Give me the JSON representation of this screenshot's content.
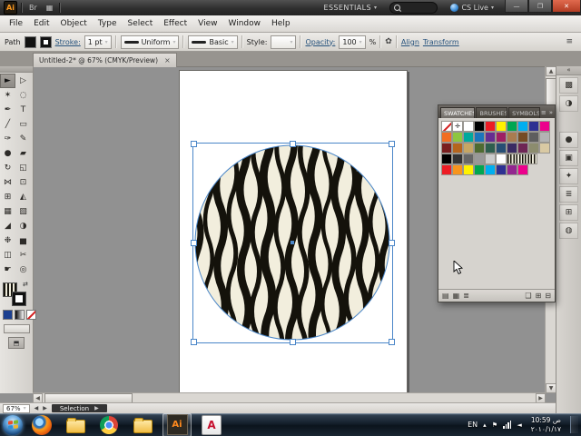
{
  "colors": {
    "selection_blue": "#4a86c8",
    "zebra_ink": "#14120b",
    "zebra_bg": "#f2eedd"
  },
  "titlebar": {
    "app_icon": "Ai",
    "bridge_icon": "Br",
    "arrange_icon_glyph": "▦",
    "workspace_button": "ESSENTIALS",
    "search_placeholder": "",
    "cs_live_button": "CS Live",
    "minimize": "—",
    "restore": "❐",
    "close": "✕"
  },
  "menubar": {
    "items": [
      "File",
      "Edit",
      "Object",
      "Type",
      "Select",
      "Effect",
      "View",
      "Window",
      "Help"
    ]
  },
  "controlbar": {
    "object_type": "Path",
    "stroke_link": "Stroke:",
    "stroke_weight": "1 pt",
    "width_profile": "Uniform",
    "brush_definition": "Basic",
    "style_label": "Style:",
    "opacity_link": "Opacity:",
    "opacity_value": "100",
    "opacity_unit": "%",
    "recolor_glyph": "✿",
    "align_link": "Align",
    "transform_link": "Transform",
    "panel_menu_glyph": "≡"
  },
  "tabbar": {
    "document_title": "Untitled-2* @ 67% (CMYK/Preview)",
    "close": "×"
  },
  "toolbar": {
    "active_index": 0,
    "tools": [
      {
        "name": "selection-tool-icon",
        "glyph": "►"
      },
      {
        "name": "direct-selection-tool-icon",
        "glyph": "▷"
      },
      {
        "name": "magic-wand-tool-icon",
        "glyph": "✶"
      },
      {
        "name": "lasso-tool-icon",
        "glyph": "◌"
      },
      {
        "name": "pen-tool-icon",
        "glyph": "✒"
      },
      {
        "name": "type-tool-icon",
        "glyph": "T"
      },
      {
        "name": "line-segment-tool-icon",
        "glyph": "╱"
      },
      {
        "name": "rectangle-tool-icon",
        "glyph": "▭"
      },
      {
        "name": "paintbrush-tool-icon",
        "glyph": "✑"
      },
      {
        "name": "pencil-tool-icon",
        "glyph": "✎"
      },
      {
        "name": "blob-brush-tool-icon",
        "glyph": "●"
      },
      {
        "name": "eraser-tool-icon",
        "glyph": "▰"
      },
      {
        "name": "rotate-tool-icon",
        "glyph": "↻"
      },
      {
        "name": "scale-tool-icon",
        "glyph": "◱"
      },
      {
        "name": "width-tool-icon",
        "glyph": "⋈"
      },
      {
        "name": "free-transform-tool-icon",
        "glyph": "⊡"
      },
      {
        "name": "shape-builder-tool-icon",
        "glyph": "⊞"
      },
      {
        "name": "perspective-grid-tool-icon",
        "glyph": "◭"
      },
      {
        "name": "mesh-tool-icon",
        "glyph": "▦"
      },
      {
        "name": "gradient-tool-icon",
        "glyph": "▧"
      },
      {
        "name": "eyedropper-tool-icon",
        "glyph": "◢"
      },
      {
        "name": "blend-tool-icon",
        "glyph": "◑"
      },
      {
        "name": "symbol-sprayer-tool-icon",
        "glyph": "❉"
      },
      {
        "name": "column-graph-tool-icon",
        "glyph": "▅"
      },
      {
        "name": "artboard-tool-icon",
        "glyph": "◫"
      },
      {
        "name": "slice-tool-icon",
        "glyph": "✂"
      },
      {
        "name": "hand-tool-icon",
        "glyph": "☛"
      },
      {
        "name": "zoom-tool-icon",
        "glyph": "◎"
      }
    ]
  },
  "swatches_panel": {
    "tabs": [
      "SWATCHES",
      "BRUSHES",
      "SYMBOLS"
    ],
    "active_tab": 0,
    "header_icons": [
      "≡",
      "»"
    ],
    "rows": [
      [
        "none",
        "registration",
        "#ffffff",
        "#000000",
        "#ed1c24",
        "#fff200",
        "#00a651",
        "#00aeef",
        "#2e3192",
        "#ec008c"
      ],
      [
        "#f26d21",
        "#8dc63f",
        "#00a99d",
        "#1b75bc",
        "#662d91",
        "#9e1f63",
        "#a97c50",
        "#754c24",
        "#5e5e5e",
        "#b3b3b3"
      ],
      [
        "#7a1f1f",
        "#b5651d",
        "#c6a664",
        "#4e6b31",
        "#2e5e4e",
        "#274e74",
        "#3a2b63",
        "#6e2555",
        "#8c8c6e",
        "#d9c9a3"
      ],
      [
        "#000000",
        "#333333",
        "#666666",
        "#999999",
        "#cccccc",
        "#ffffff",
        "pattern"
      ],
      [
        "#ed1c24",
        "#f7941d",
        "#fff200",
        "#00a651",
        "#00aeef",
        "#2e3192",
        "#92278f",
        "#ec008c"
      ]
    ],
    "footer_icons": [
      {
        "name": "swatch-libraries-icon",
        "glyph": "▤"
      },
      {
        "name": "swatch-kinds-icon",
        "glyph": "▦"
      },
      {
        "name": "swatch-options-icon",
        "glyph": "≣"
      },
      {
        "name": "new-color-group-icon",
        "glyph": "❑"
      },
      {
        "name": "new-swatch-icon",
        "glyph": "⊞"
      },
      {
        "name": "delete-swatch-icon",
        "glyph": "⊟"
      }
    ]
  },
  "dock": {
    "collapse_glyph": "«",
    "icons": [
      {
        "name": "color-panel-icon",
        "glyph": "▩"
      },
      {
        "name": "color-guide-panel-icon",
        "glyph": "◑"
      },
      {
        "name": "appearance-panel-icon",
        "glyph": "●"
      },
      {
        "name": "graphic-styles-panel-icon",
        "glyph": "▣"
      },
      {
        "name": "symbols-panel-icon",
        "glyph": "✦"
      },
      {
        "name": "layers-panel-icon",
        "glyph": "≣"
      },
      {
        "name": "artboards-panel-icon",
        "glyph": "⊞"
      },
      {
        "name": "navigator-panel-icon",
        "glyph": "◍"
      }
    ]
  },
  "statusbar": {
    "zoom": "67%",
    "prev_glyph": "◀",
    "next_glyph": "▶",
    "status_label": "Selection",
    "chip_arrow": "▶"
  },
  "taskbar": {
    "ai_label": "Ai",
    "reader_label": "A",
    "tray": {
      "language": "EN",
      "hidden_icons_glyph": "▴",
      "action_center_glyph": "⚑",
      "volume_glyph": "◄"
    },
    "time": "10:59 ص",
    "date": "٢٠١٠/١/١٧"
  }
}
